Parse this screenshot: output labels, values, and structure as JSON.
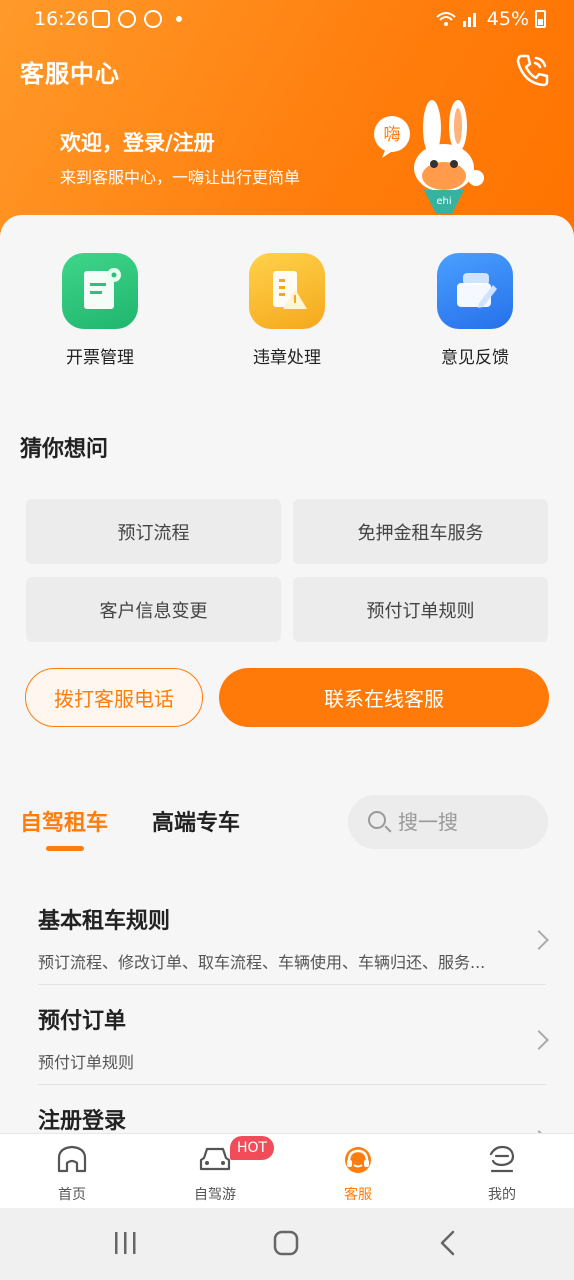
{
  "status_bar": {
    "time": "16:26",
    "battery": "45%"
  },
  "header": {
    "title": "客服中心",
    "welcome": "欢迎，登录/注册",
    "subtitle": "来到客服中心，一嗨让出行更简单",
    "mascot_bubble": "嗨",
    "mascot_badge": "ehi"
  },
  "quick_actions": [
    {
      "label": "开票管理",
      "icon": "invoice-icon",
      "color": "#27c27b"
    },
    {
      "label": "违章处理",
      "icon": "violation-icon",
      "color": "#f9b92a"
    },
    {
      "label": "意见反馈",
      "icon": "feedback-icon",
      "color": "#2e7ff0"
    }
  ],
  "guess": {
    "title": "猜你想问",
    "items": [
      "预订流程",
      "免押金租车服务",
      "客户信息变更",
      "预付订单规则"
    ]
  },
  "buttons": {
    "call": "拨打客服电话",
    "online": "联系在线客服"
  },
  "tabs": {
    "self_drive": "自驾租车",
    "premium": "高端专车"
  },
  "search": {
    "placeholder": "搜一搜"
  },
  "faq": [
    {
      "title": "基本租车规则",
      "desc": "预订流程、修改订单、取车流程、车辆使用、车辆归还、服务..."
    },
    {
      "title": "预付订单",
      "desc": "预付订单规则"
    },
    {
      "title": "注册登录",
      "desc": ""
    }
  ],
  "tabbar": {
    "items": [
      {
        "label": "首页",
        "icon": "home-icon"
      },
      {
        "label": "自驾游",
        "icon": "car-icon"
      },
      {
        "label": "客服",
        "icon": "headset-icon"
      },
      {
        "label": "我的",
        "icon": "profile-icon"
      }
    ],
    "hot_badge": "HOT"
  },
  "colors": {
    "accent": "#ff7d0c",
    "text": "#222222",
    "card": "#ececec"
  }
}
